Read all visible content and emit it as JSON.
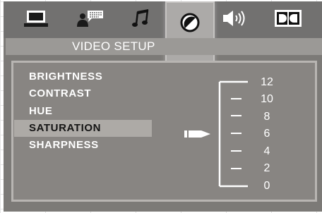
{
  "tabs": [
    {
      "name": "general-setup",
      "icon": "laptop-icon",
      "active": false
    },
    {
      "name": "speaker-setup",
      "icon": "person-speech-icon",
      "active": false
    },
    {
      "name": "audio-setup",
      "icon": "music-note-icon",
      "active": false
    },
    {
      "name": "video-setup",
      "icon": "contrast-circle-icon",
      "active": true
    },
    {
      "name": "volume-setup",
      "icon": "speaker-volume-icon",
      "active": false
    },
    {
      "name": "dolby-setup",
      "icon": "dolby-icon",
      "active": false
    }
  ],
  "title": "VIDEO SETUP",
  "menu": {
    "items": [
      {
        "label": "BRIGHTNESS",
        "selected": false
      },
      {
        "label": "CONTRAST",
        "selected": false
      },
      {
        "label": "HUE",
        "selected": false
      },
      {
        "label": "SATURATION",
        "selected": true
      },
      {
        "label": "SHARPNESS",
        "selected": false
      }
    ]
  },
  "scale": {
    "labels": [
      "12",
      "10",
      "8",
      "6",
      "4",
      "2",
      "0"
    ],
    "current_value": 6
  },
  "colors": {
    "osd_background": "#7c7a77",
    "highlight": "#adaaa6",
    "text": "#ffffff"
  }
}
